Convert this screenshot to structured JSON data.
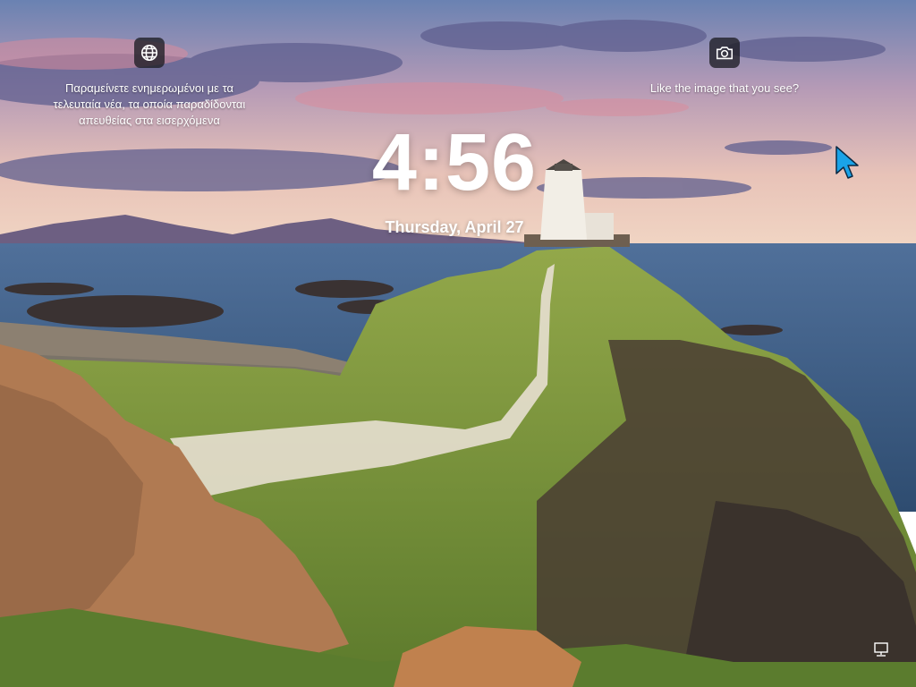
{
  "lock_screen": {
    "time": "4:56",
    "date": "Thursday, April 27"
  },
  "widgets": {
    "news": {
      "icon": "globe-icon",
      "text": "Παραμείνετε ενημερωμένοι με τα τελευταία νέα, τα οποία παραδίδονται απευθείας στα εισερχόμενα"
    },
    "photo": {
      "icon": "camera-icon",
      "text": "Like the image that you see?"
    }
  },
  "status": {
    "network_icon": "network-icon"
  },
  "colors": {
    "sky_top": "#6f86b5",
    "sea": "#3f5f83",
    "grass": "#7d9a3d",
    "rock": "#8a5a3c",
    "widget_bg": "#1e1e24",
    "cursor": "#1aa3e8"
  }
}
